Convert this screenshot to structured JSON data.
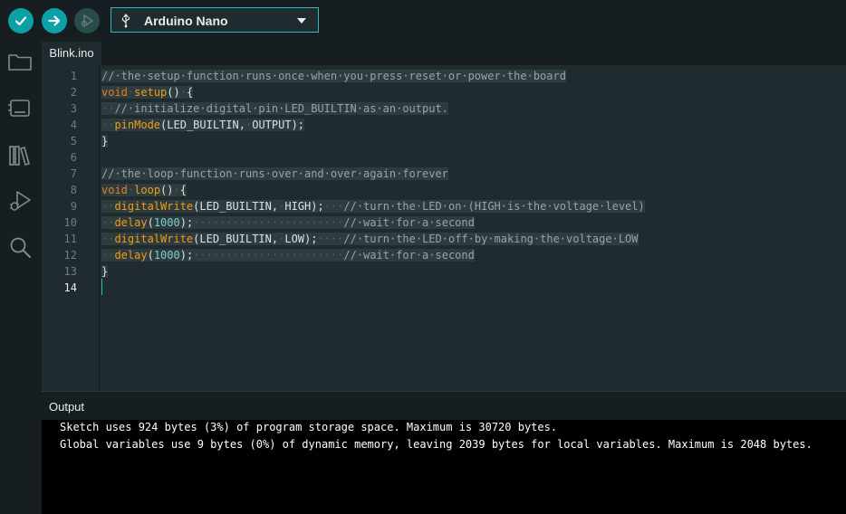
{
  "toolbar": {
    "verify_icon": "check-icon",
    "upload_icon": "arrow-right-icon",
    "debug_icon": "debug-play-icon",
    "board": {
      "icon": "usb-icon",
      "name": "Arduino Nano",
      "caret_icon": "caret-down-icon"
    }
  },
  "sidebar": {
    "items": [
      {
        "icon": "folder-icon",
        "label": "Sketchbook"
      },
      {
        "icon": "board-manager-icon",
        "label": "Boards Manager"
      },
      {
        "icon": "library-icon",
        "label": "Library Manager"
      },
      {
        "icon": "debug-icon",
        "label": "Debug"
      },
      {
        "icon": "search-icon",
        "label": "Search"
      }
    ]
  },
  "tabs": [
    {
      "label": "Blink.ino",
      "active": true
    }
  ],
  "editor": {
    "line_numbers": [
      "1",
      "2",
      "3",
      "4",
      "5",
      "6",
      "7",
      "8",
      "9",
      "10",
      "11",
      "12",
      "13",
      "14"
    ],
    "active_line": "14",
    "lines": [
      "//·the·setup·function·runs·once·when·you·press·reset·or·power·the·board",
      "void·setup()·{",
      "··//·initialize·digital·pin·LED_BUILTIN·as·an·output.",
      "··pinMode(LED_BUILTIN,·OUTPUT);",
      "}",
      "",
      "//·the·loop·function·runs·over·and·over·again·forever",
      "void·loop()·{",
      "··digitalWrite(LED_BUILTIN,·HIGH);···//·turn·the·LED·on·(HIGH·is·the·voltage·level)",
      "··delay(1000);·······················//·wait·for·a·second",
      "··digitalWrite(LED_BUILTIN,·LOW);····//·turn·the·LED·off·by·making·the·voltage·LOW",
      "··delay(1000);·······················//·wait·for·a·second",
      "}",
      ""
    ]
  },
  "output": {
    "title": "Output",
    "lines": [
      "Sketch uses 924 bytes (3%) of program storage space. Maximum is 30720 bytes.",
      "Global variables use 9 bytes (0%) of dynamic memory, leaving 2039 bytes for local variables. Maximum is 2048 bytes."
    ]
  },
  "colors": {
    "accent": "#0ca1a6",
    "background": "#171e21",
    "editor_bg": "#1f2b2e",
    "output_bg": "#000000",
    "keyword": "#e67e22",
    "function": "#f39c12",
    "comment": "#95a5a6",
    "number": "#7fcbcd"
  }
}
